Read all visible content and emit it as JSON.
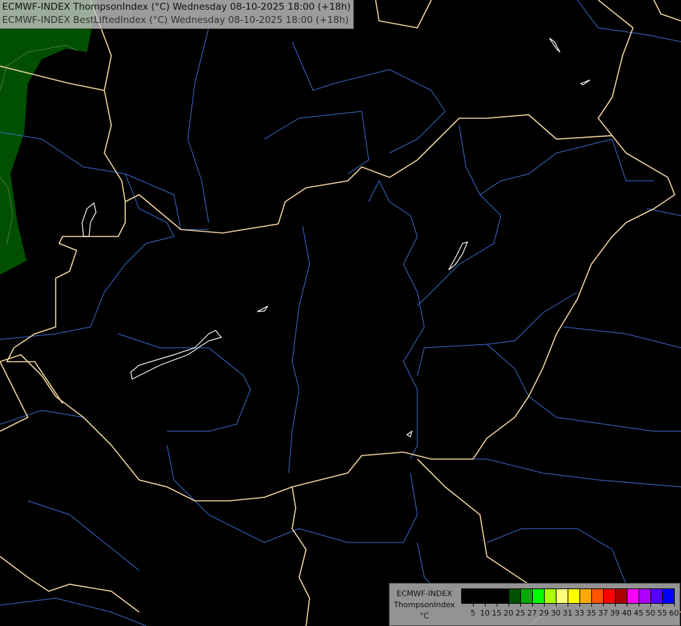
{
  "title": {
    "line1": "ECMWF-INDEX ThompsonIndex (°C) Wednesday 08-10-2025 18:00 (+18h)",
    "line2": "ECMWF-INDEX BestLiftedIndex (°C) Wednesday 08-10-2025 18:00 (+18h)"
  },
  "map": {
    "background_color": "#000000",
    "border_color": "#f5d6a0",
    "river_color": "#3a6fd6",
    "lake_color": "#ffffff",
    "index_area_color": "#005000"
  },
  "legend": {
    "line1": "ECMWF-INDEX",
    "line2": "ThompsonIndex",
    "unit": "°C",
    "colors": [
      "#000000",
      "#000000",
      "#000000",
      "#000000",
      "#005000",
      "#00aa00",
      "#00ff00",
      "#aaff00",
      "#ffff80",
      "#ffff00",
      "#ffaa00",
      "#ff5500",
      "#ff0000",
      "#aa0000",
      "#ff00ff",
      "#aa00ff",
      "#5500ff",
      "#0000ff"
    ],
    "ticks": [
      "5",
      "10",
      "15",
      "20",
      "25",
      "27",
      "29",
      "30",
      "31",
      "33",
      "35",
      "37",
      "39",
      "40",
      "45",
      "50",
      "55",
      "60"
    ]
  }
}
